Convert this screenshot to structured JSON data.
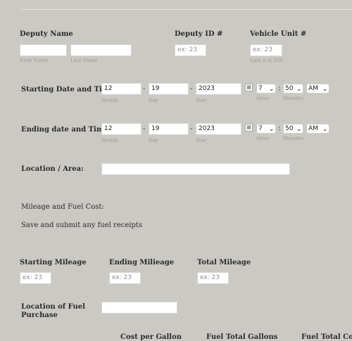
{
  "deputy": {
    "name_label": "Deputy Name",
    "first_sub": "First Name",
    "last_sub": "Last Name",
    "id_label": "Deputy ID #",
    "id_placeholder": "ex: 23",
    "vehicle_label": "Vehicle Unit #",
    "vehicle_placeholder": "ex: 23",
    "vehicle_sub": "Last 4 of VIN"
  },
  "start": {
    "label": "Starting Date and Time",
    "month": "12",
    "day": "19",
    "year": "2023",
    "month_sub": "Month",
    "day_sub": "Day",
    "year_sub": "Year",
    "hour": "7",
    "minute": "50",
    "ampm": "AM",
    "hour_sub": "Hour",
    "minute_sub": "Minutes",
    "sep_date": "-",
    "sep_time": ":"
  },
  "end": {
    "label": "Ending date and Time",
    "month": "12",
    "day": "19",
    "year": "2023",
    "month_sub": "Month",
    "day_sub": "Day",
    "year_sub": "Year",
    "hour": "7",
    "minute": "50",
    "ampm": "AM",
    "hour_sub": "Hour",
    "minute_sub": "Minutes",
    "sep_date": "-",
    "sep_time": ":"
  },
  "location": {
    "label": "Location / Area:"
  },
  "mileage_section": {
    "heading": "Mileage and Fuel Cost:",
    "note": "Save and submit any fuel receipts"
  },
  "mileage": {
    "start_label": "Starting Mileage",
    "start_placeholder": "ex: 23",
    "end_label": "Ending Milieage",
    "end_placeholder": "ex: 23",
    "total_label": "Total Mileage",
    "total_placeholder": "ex: 23"
  },
  "fuel": {
    "location_label_line1": "Location of Fuel",
    "location_label_line2": "Purchase",
    "col_cost_per_gallon": "Cost per Gallon",
    "col_total_gallons": "Fuel Total Gallons",
    "col_total_cost": "Fuel Total Cost"
  },
  "icons": {
    "calendar": "calendar-icon",
    "chevron": "chevron-down-icon"
  }
}
